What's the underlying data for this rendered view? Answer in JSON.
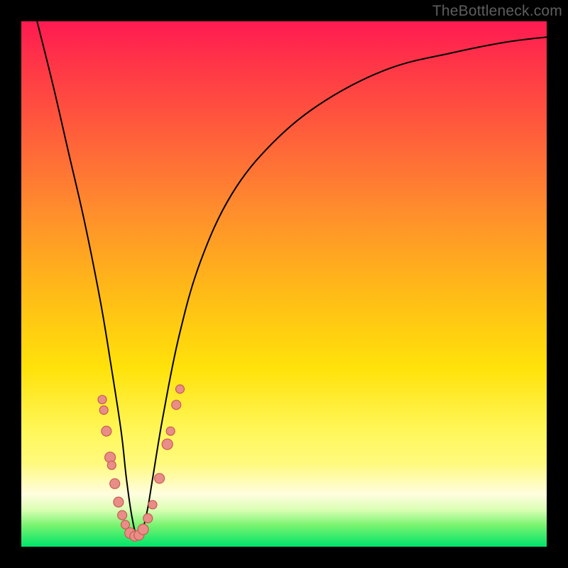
{
  "watermark": "TheBottleneck.com",
  "chart_data": {
    "type": "line",
    "title": "",
    "xlabel": "",
    "ylabel": "",
    "xlim": [
      0,
      100
    ],
    "ylim": [
      0,
      100
    ],
    "grid": false,
    "axes_visible": false,
    "background": "vertical rainbow gradient, red top to green bottom",
    "description": "Single V-shaped bottleneck curve; minimum (best) near x≈22; markers clustered near minimum on both branches.",
    "series": [
      {
        "name": "bottleneck-curve",
        "x": [
          3,
          6,
          9,
          12,
          15,
          17,
          19,
          20,
          21,
          22,
          23,
          24,
          25,
          27,
          30,
          34,
          40,
          48,
          58,
          70,
          82,
          92,
          100
        ],
        "y": [
          100,
          88,
          75,
          62,
          47,
          35,
          22,
          13,
          6,
          2,
          3,
          7,
          13,
          25,
          40,
          54,
          67,
          77,
          85,
          91,
          94,
          96,
          97
        ]
      }
    ],
    "markers": [
      {
        "x": 15.4,
        "y": 28,
        "r": 6
      },
      {
        "x": 15.7,
        "y": 26,
        "r": 6
      },
      {
        "x": 16.2,
        "y": 22,
        "r": 7
      },
      {
        "x": 16.9,
        "y": 17,
        "r": 7.5
      },
      {
        "x": 17.2,
        "y": 15.5,
        "r": 6
      },
      {
        "x": 17.8,
        "y": 12,
        "r": 7
      },
      {
        "x": 18.5,
        "y": 8.5,
        "r": 7
      },
      {
        "x": 19.2,
        "y": 6,
        "r": 6.5
      },
      {
        "x": 19.8,
        "y": 4.2,
        "r": 6
      },
      {
        "x": 20.7,
        "y": 2.6,
        "r": 7.5
      },
      {
        "x": 21.6,
        "y": 2.0,
        "r": 7
      },
      {
        "x": 22.4,
        "y": 2.2,
        "r": 7
      },
      {
        "x": 23.2,
        "y": 3.3,
        "r": 7.5
      },
      {
        "x": 24.1,
        "y": 5.4,
        "r": 6.5
      },
      {
        "x": 25.0,
        "y": 8.0,
        "r": 6
      },
      {
        "x": 26.3,
        "y": 13,
        "r": 7
      },
      {
        "x": 27.8,
        "y": 19.5,
        "r": 7.5
      },
      {
        "x": 28.4,
        "y": 22,
        "r": 6
      },
      {
        "x": 29.5,
        "y": 27,
        "r": 6.5
      },
      {
        "x": 30.2,
        "y": 30,
        "r": 6
      }
    ]
  }
}
